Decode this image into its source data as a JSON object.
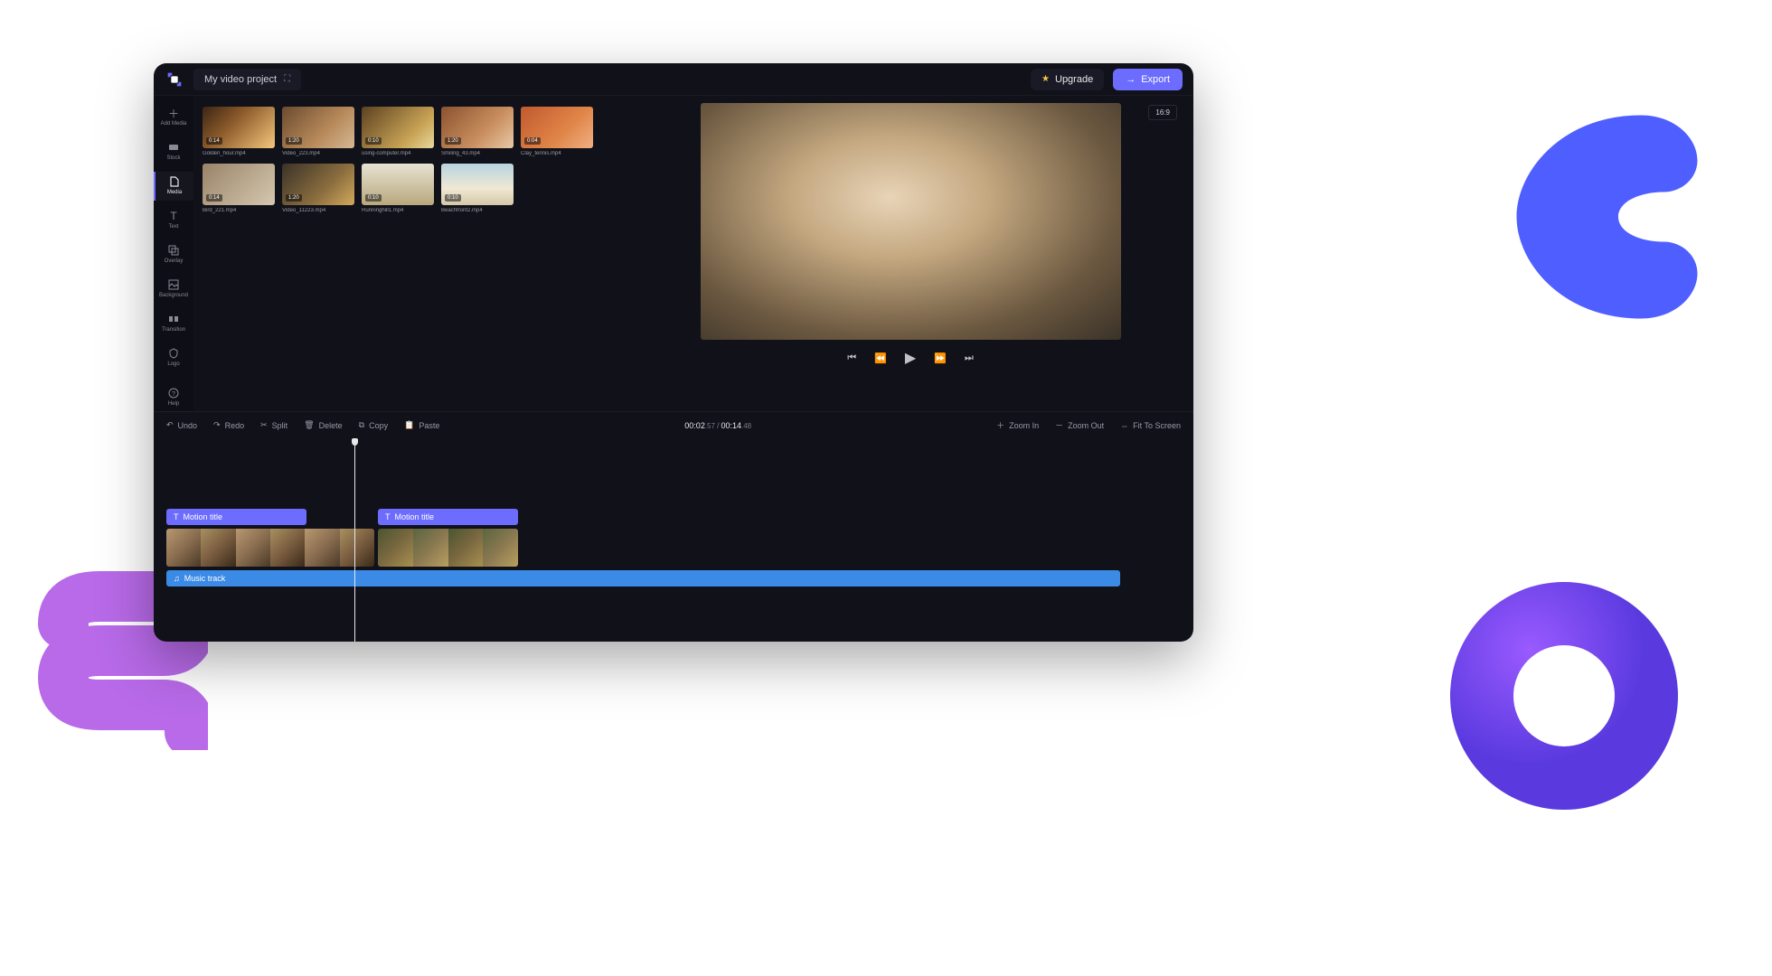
{
  "header": {
    "project_name": "My video project",
    "upgrade_label": "Upgrade",
    "export_label": "Export",
    "aspect_ratio": "16:9"
  },
  "sidebar": {
    "items": [
      {
        "label": "Add Media",
        "icon": "plus"
      },
      {
        "label": "Stock",
        "icon": "stock"
      },
      {
        "label": "Media",
        "icon": "file"
      },
      {
        "label": "Text",
        "icon": "text"
      },
      {
        "label": "Overlay",
        "icon": "overlay"
      },
      {
        "label": "Background",
        "icon": "background"
      },
      {
        "label": "Transition",
        "icon": "transition"
      },
      {
        "label": "Logo",
        "icon": "shield"
      }
    ],
    "help_label": "Help"
  },
  "media": {
    "items": [
      {
        "name": "Golden_hour.mp4",
        "duration": "0:14",
        "thumb": "thumb-sunset"
      },
      {
        "name": "Video_223.mp4",
        "duration": "1:20",
        "thumb": "thumb-dog"
      },
      {
        "name": "using-computer.mp4",
        "duration": "0:10",
        "thumb": "thumb-laptop"
      },
      {
        "name": "Smiling_43.mp4",
        "duration": "1:20",
        "thumb": "thumb-smile"
      },
      {
        "name": "Clay_tennis.mp4",
        "duration": "0:04",
        "thumb": "thumb-tennis"
      },
      {
        "name": "Bird_221.mp4",
        "duration": "0:14",
        "thumb": "thumb-bird"
      },
      {
        "name": "Video_11223.mp4",
        "duration": "1:20",
        "thumb": "thumb-rocks"
      },
      {
        "name": "Runninghill1.mp4",
        "duration": "0:10",
        "thumb": "thumb-runner"
      },
      {
        "name": "Beachfront2.mp4",
        "duration": "0:10",
        "thumb": "thumb-beach"
      }
    ]
  },
  "toolbar": {
    "undo": "Undo",
    "redo": "Redo",
    "split": "Split",
    "delete": "Delete",
    "copy": "Copy",
    "paste": "Paste",
    "zoom_in": "Zoom In",
    "zoom_out": "Zoom Out",
    "fit": "Fit To Screen"
  },
  "timecode": {
    "current_main": "00:02",
    "current_sub": ".57",
    "total_main": "00:14",
    "total_sub": ".48"
  },
  "timeline": {
    "title_clip_1": "Motion title",
    "title_clip_2": "Motion title",
    "audio_clip": "Music track"
  }
}
